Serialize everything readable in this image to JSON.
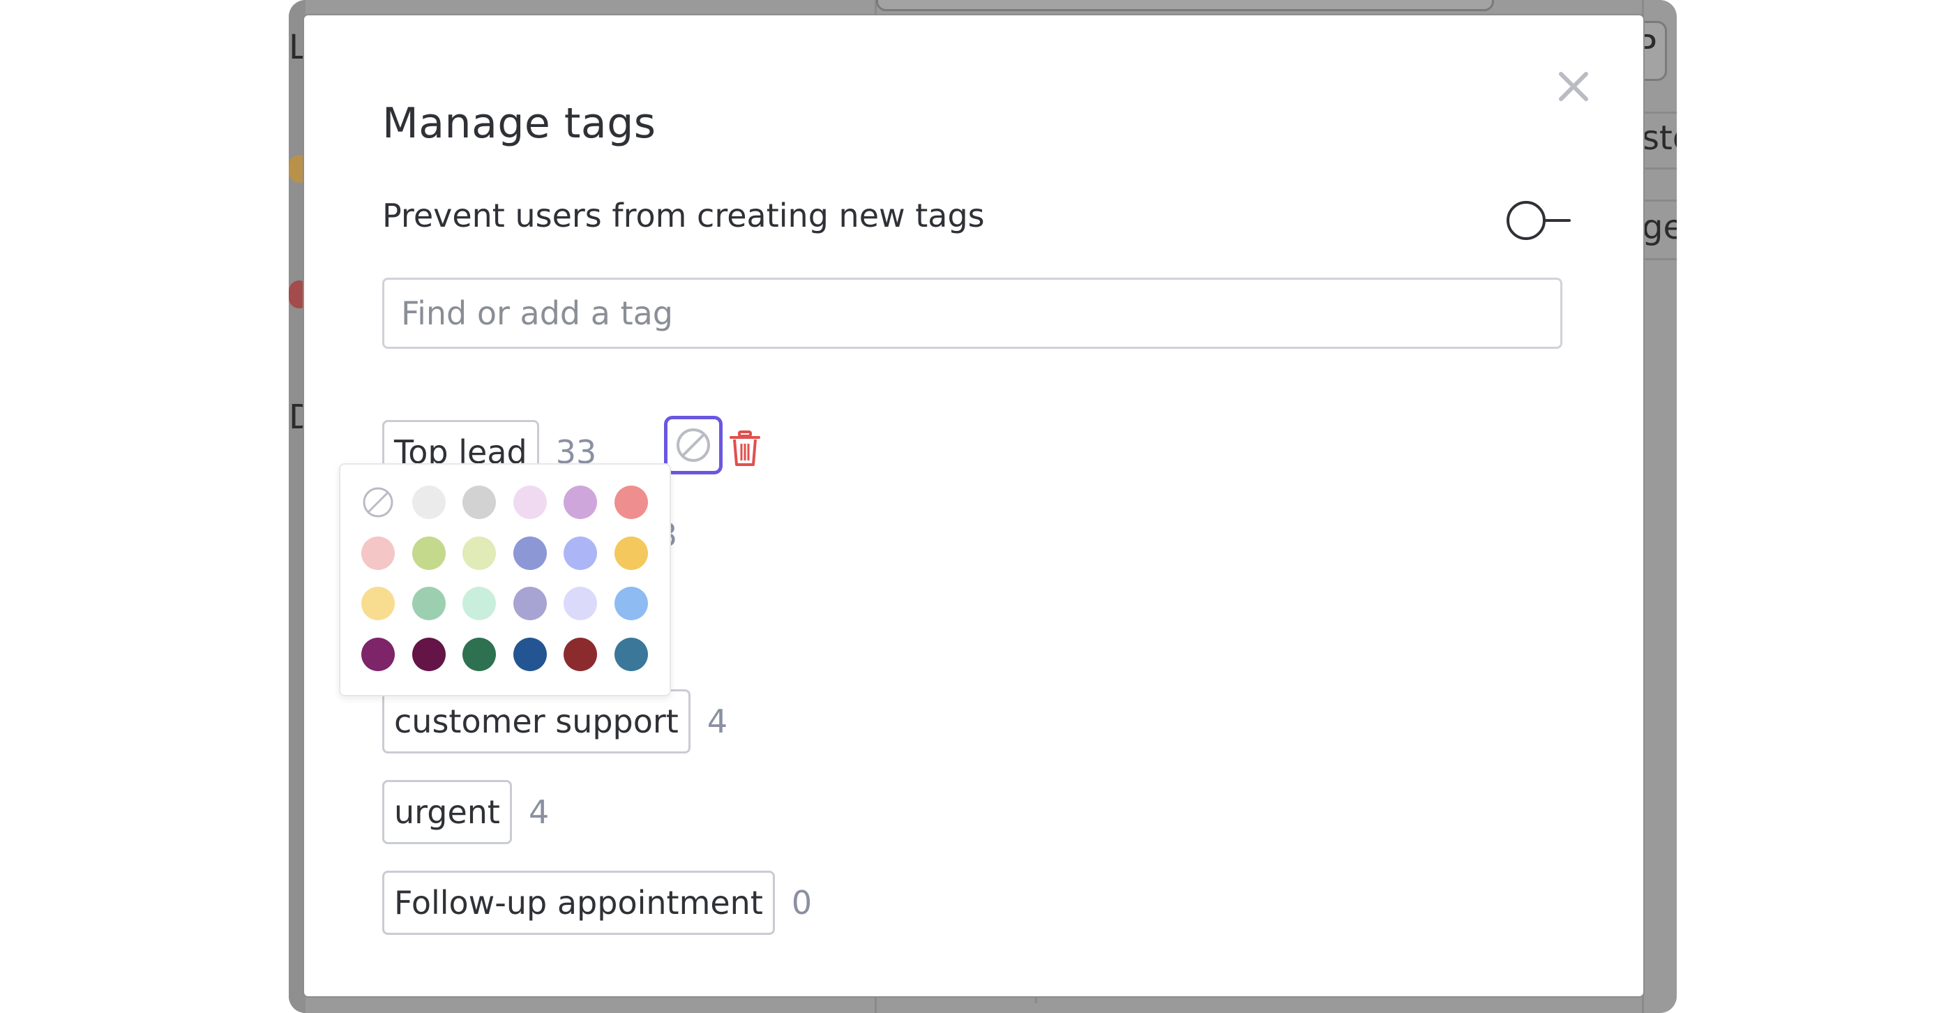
{
  "backdrop": {
    "fragments": [
      "L",
      "D",
      "P",
      "sto",
      "ge"
    ]
  },
  "modal": {
    "title": "Manage tags",
    "close_icon": "close-icon",
    "preference": {
      "label": "Prevent users from creating new tags",
      "toggle_on": false
    },
    "search": {
      "placeholder": "Find or add a tag",
      "value": ""
    },
    "tags": [
      {
        "label": "Top lead",
        "count": "33"
      },
      {
        "label": "customer support",
        "count": "4"
      },
      {
        "label": "urgent",
        "count": "4"
      },
      {
        "label": "Follow-up appointment",
        "count": "0"
      }
    ],
    "hidden_count_fragment": "3",
    "color_button_icon": "no-color-icon",
    "delete_icon": "trash-icon",
    "colors": {
      "accent": "#6a57e0",
      "delete": "#e0504c"
    },
    "color_picker": {
      "swatches": [
        [
          "none",
          "#ebebeb",
          "#d2d2d2",
          "#f0daf2",
          "#cfa6db",
          "#ef8e8e"
        ],
        [
          "#f4c6c6",
          "#c4d98c",
          "#e0ebb8",
          "#8c97d5",
          "#acb6f7",
          "#f4c85c"
        ],
        [
          "#f8dc90",
          "#9ccfb0",
          "#c9efdc",
          "#a7a3d2",
          "#dbdafb",
          "#8dbbf2"
        ],
        [
          "#7e2468",
          "#641447",
          "#2e7150",
          "#235592",
          "#8c2b2e",
          "#3a7799"
        ]
      ]
    }
  }
}
